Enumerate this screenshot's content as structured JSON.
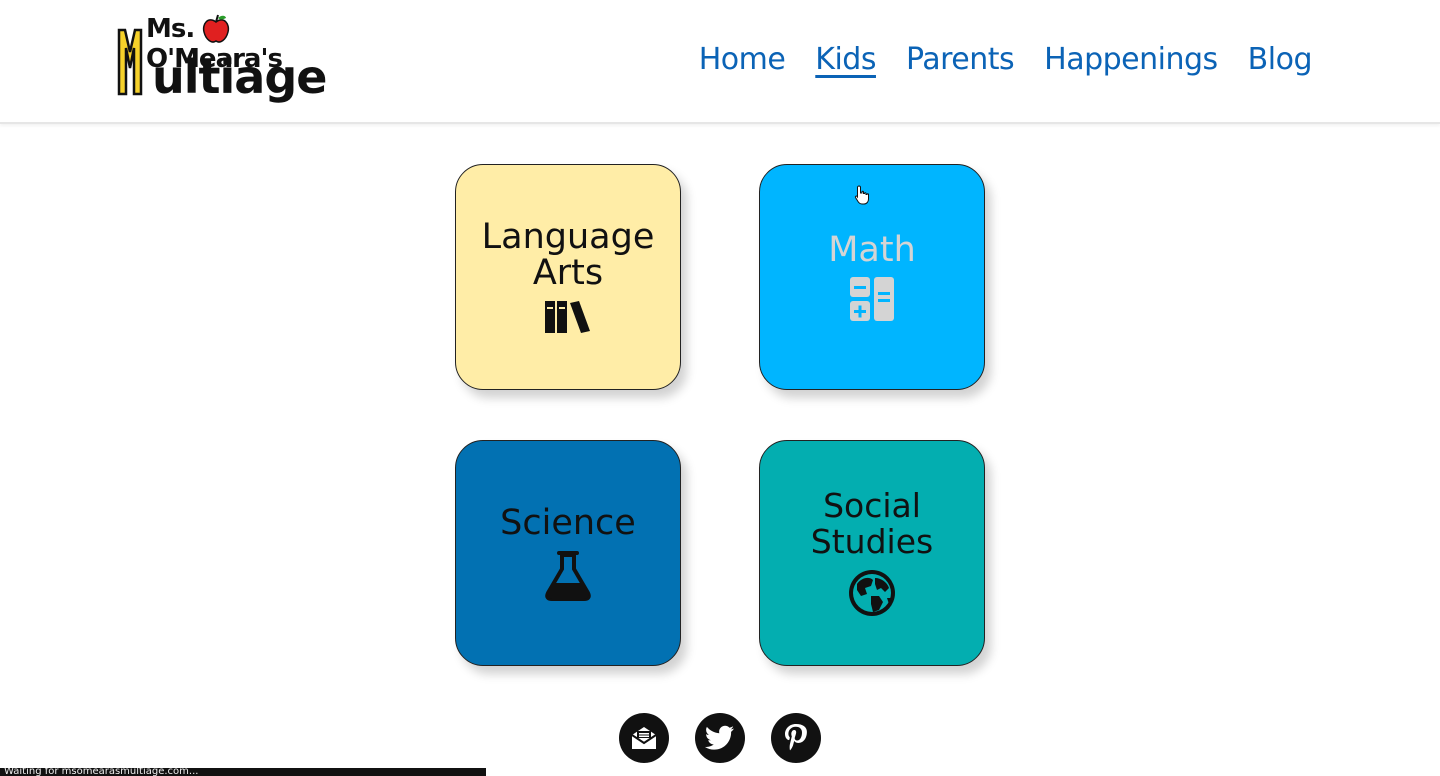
{
  "logo": {
    "top_text": "Ms. O'Meara's",
    "bottom_text": "ultiage",
    "accent": "#e02020"
  },
  "nav": {
    "items": [
      {
        "label": "Home"
      },
      {
        "label": "Kids"
      },
      {
        "label": "Parents"
      },
      {
        "label": "Happenings"
      },
      {
        "label": "Blog"
      }
    ],
    "active": "Kids"
  },
  "tiles": [
    {
      "label_line1": "Language",
      "label_line2": "Arts",
      "icon": "books-icon",
      "color": "#ffeda7"
    },
    {
      "label": "Math",
      "icon": "calculator-icon",
      "color": "#00b5ff"
    },
    {
      "label": "Science",
      "icon": "flask-icon",
      "color": "#0271b2"
    },
    {
      "label": "Social Studies",
      "icon": "globe-icon",
      "color": "#03aeb0"
    }
  ],
  "social": [
    {
      "icon": "newsletter-icon"
    },
    {
      "icon": "twitter-icon"
    },
    {
      "icon": "pinterest-icon"
    }
  ],
  "status": {
    "text": "Waiting for msomearasmultiage.com..."
  }
}
